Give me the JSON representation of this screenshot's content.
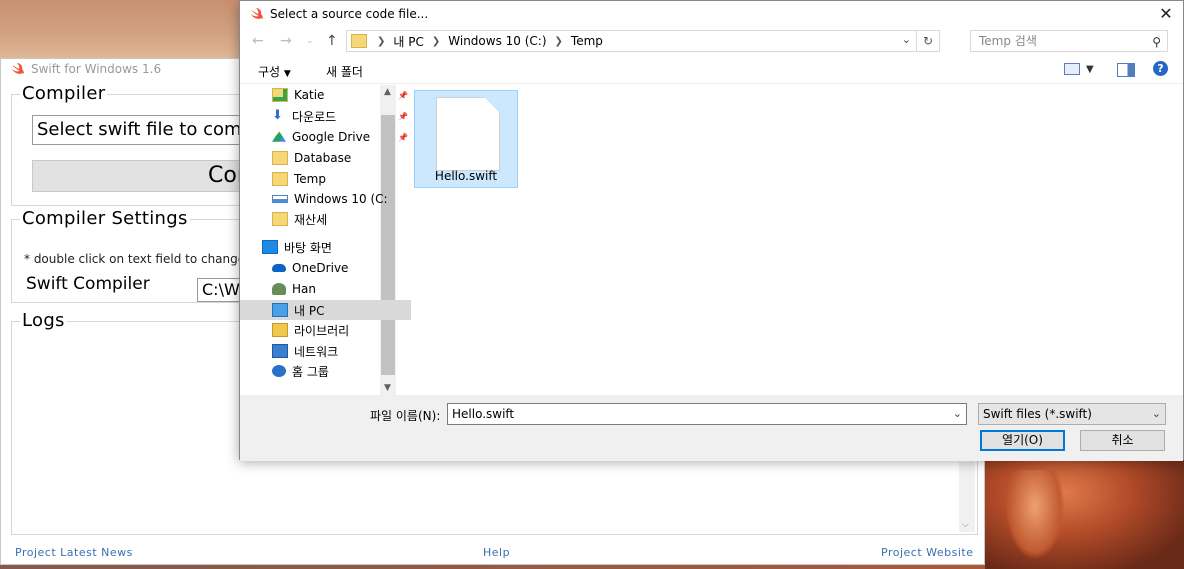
{
  "app": {
    "title": "Swift for Windows 1.6",
    "compiler_group": "Compiler",
    "file_input_placeholder": "Select swift file to compile",
    "compile_button": "Compile",
    "settings_group": "Compiler Settings",
    "settings_hint": "* double click on text field to change",
    "compiler_label": "Swift Compiler",
    "compiler_path": "C:\\W",
    "logs_group": "Logs",
    "footer": {
      "news": "Project Latest News",
      "help": "Help",
      "website": "Project Website"
    }
  },
  "dialog": {
    "title": "Select a source code file...",
    "breadcrumb": [
      "내 PC",
      "Windows 10 (C:)",
      "Temp"
    ],
    "search_placeholder": "Temp 검색",
    "toolbar": {
      "organize": "구성",
      "new_folder": "새 폴더"
    },
    "nav_items": [
      {
        "label": "Katie",
        "icon": "folder-green-check-icon",
        "pinned": true
      },
      {
        "label": "다운로드",
        "icon": "download-arrow-icon",
        "pinned": true
      },
      {
        "label": "Google Drive",
        "icon": "google-drive-icon",
        "pinned": true
      },
      {
        "label": "Database",
        "icon": "folder-check-icon",
        "pinned": false
      },
      {
        "label": "Temp",
        "icon": "folder-icon",
        "pinned": false
      },
      {
        "label": "Windows 10 (C:",
        "icon": "drive-icon",
        "pinned": false
      },
      {
        "label": "재산세",
        "icon": "folder-check-icon",
        "pinned": false
      },
      {
        "label": "바탕 화면",
        "icon": "desktop-icon",
        "pinned": false
      },
      {
        "label": "OneDrive",
        "icon": "onedrive-icon",
        "pinned": false
      },
      {
        "label": "Han",
        "icon": "user-icon",
        "pinned": false
      },
      {
        "label": "내 PC",
        "icon": "computer-icon",
        "pinned": false,
        "selected": true
      },
      {
        "label": "라이브러리",
        "icon": "library-icon",
        "pinned": false
      },
      {
        "label": "네트워크",
        "icon": "network-icon",
        "pinned": false
      },
      {
        "label": "홈 그룹",
        "icon": "homegroup-icon",
        "pinned": false
      }
    ],
    "files": [
      {
        "name": "Hello.swift",
        "icon": "document-icon"
      }
    ],
    "filename_label": "파일 이름(N):",
    "filename_value": "Hello.swift",
    "filetype_value": "Swift files (*.swift)",
    "open_button": "열기(O)",
    "cancel_button": "취소"
  },
  "colors": {
    "selection": "#cce8ff",
    "link": "#3a6fb0",
    "accent": "#0078d7"
  }
}
